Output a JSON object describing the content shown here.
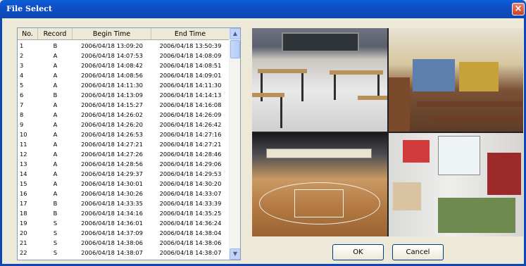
{
  "window": {
    "title": "File Select",
    "close_glyph": "×"
  },
  "list": {
    "columns": [
      "No.",
      "Record",
      "Begin Time",
      "End Time"
    ],
    "rows": [
      [
        "1",
        "B",
        "2006/04/18 13:09:20",
        "2006/04/18 13:50:39"
      ],
      [
        "2",
        "A",
        "2006/04/18 14:07:53",
        "2006/04/18 14:08:09"
      ],
      [
        "3",
        "A",
        "2006/04/18 14:08:42",
        "2006/04/18 14:08:51"
      ],
      [
        "4",
        "A",
        "2006/04/18 14:08:56",
        "2006/04/18 14:09:01"
      ],
      [
        "5",
        "A",
        "2006/04/18 14:11:30",
        "2006/04/18 14:11:30"
      ],
      [
        "6",
        "B",
        "2006/04/18 14:13:09",
        "2006/04/18 14:14:13"
      ],
      [
        "7",
        "A",
        "2006/04/18 14:15:27",
        "2006/04/18 14:16:08"
      ],
      [
        "8",
        "A",
        "2006/04/18 14:26:02",
        "2006/04/18 14:26:09"
      ],
      [
        "9",
        "A",
        "2006/04/18 14:26:20",
        "2006/04/18 14:26:42"
      ],
      [
        "10",
        "A",
        "2006/04/18 14:26:53",
        "2006/04/18 14:27:16"
      ],
      [
        "11",
        "A",
        "2006/04/18 14:27:21",
        "2006/04/18 14:27:21"
      ],
      [
        "12",
        "A",
        "2006/04/18 14:27:26",
        "2006/04/18 14:28:46"
      ],
      [
        "13",
        "A",
        "2006/04/18 14:28:56",
        "2006/04/18 14:29:06"
      ],
      [
        "14",
        "A",
        "2006/04/18 14:29:37",
        "2006/04/18 14:29:53"
      ],
      [
        "15",
        "A",
        "2006/04/18 14:30:01",
        "2006/04/18 14:30:20"
      ],
      [
        "16",
        "A",
        "2006/04/18 14:30:26",
        "2006/04/18 14:33:07"
      ],
      [
        "17",
        "B",
        "2006/04/18 14:33:35",
        "2006/04/18 14:33:39"
      ],
      [
        "18",
        "B",
        "2006/04/18 14:34:16",
        "2006/04/18 14:35:25"
      ],
      [
        "19",
        "S",
        "2006/04/18 14:36:01",
        "2006/04/18 14:36:24"
      ],
      [
        "20",
        "S",
        "2006/04/18 14:37:09",
        "2006/04/18 14:38:04"
      ],
      [
        "21",
        "S",
        "2006/04/18 14:38:06",
        "2006/04/18 14:38:06"
      ],
      [
        "22",
        "S",
        "2006/04/18 14:38:07",
        "2006/04/18 14:38:07"
      ]
    ],
    "scroll_up_glyph": "▲",
    "scroll_down_glyph": "▼"
  },
  "buttons": {
    "ok": "OK",
    "cancel": "Cancel"
  },
  "colors": {
    "titlebar": "#0b48b6",
    "dialog_bg": "#ece9d8"
  }
}
